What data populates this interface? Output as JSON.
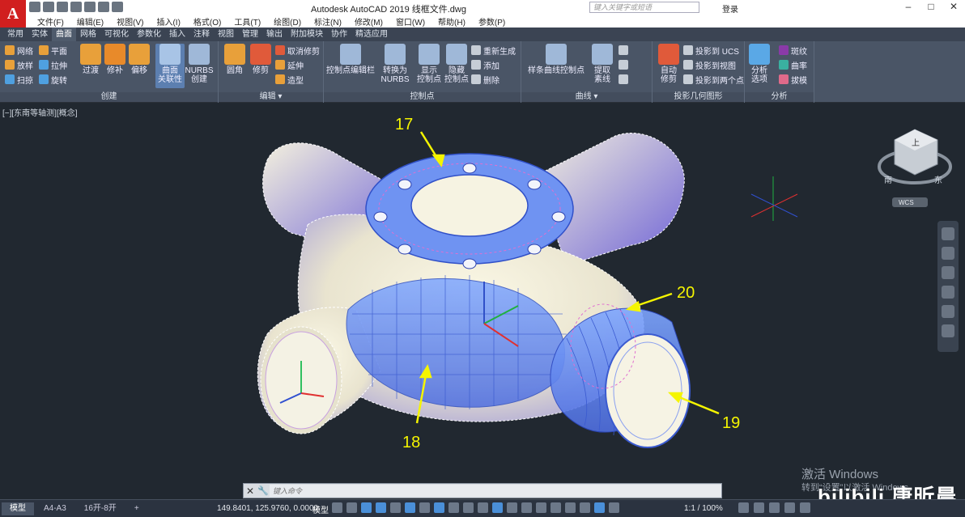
{
  "title_bar": {
    "app_title": "Autodesk AutoCAD 2019   线框文件.dwg",
    "search_placeholder": "键入关键字或短语",
    "login_label": "登录",
    "logo_letter": "A"
  },
  "menu": [
    "文件(F)",
    "编辑(E)",
    "视图(V)",
    "插入(I)",
    "格式(O)",
    "工具(T)",
    "绘图(D)",
    "标注(N)",
    "修改(M)",
    "窗口(W)",
    "帮助(H)",
    "参数(P)"
  ],
  "ribbon_tabs": [
    "常用",
    "实体",
    "曲面",
    "网格",
    "可视化",
    "参数化",
    "插入",
    "注释",
    "视图",
    "管理",
    "输出",
    "附加模块",
    "协作",
    "精选应用"
  ],
  "active_tab": "曲面",
  "panels": {
    "create": {
      "label": "创建",
      "small": [
        "网络",
        "放样",
        "扫掠",
        "平面",
        "拉伸",
        "旋转"
      ],
      "big": [
        "过渡",
        "修补",
        "偏移",
        "曲面\n关联性",
        "NURBS\n创建"
      ]
    },
    "edit": {
      "label": "编辑",
      "big": [
        "圆角",
        "修剪"
      ],
      "small": [
        "取消修剪",
        "延伸",
        "造型"
      ]
    },
    "control_points": {
      "label": "控制点",
      "big": [
        "控制点编辑栏",
        "转换为\nNURBS",
        "显示\n控制点",
        "隐藏\n控制点"
      ],
      "small": [
        "重新生成",
        "添加",
        "删除"
      ]
    },
    "curves": {
      "label": "曲线",
      "big": [
        "样条曲线控制点",
        "提取\n素线"
      ]
    },
    "projection": {
      "label": "投影几何图形",
      "big": [
        "自动\n修剪"
      ],
      "small": [
        "投影到 UCS",
        "投影到视图",
        "投影到两个点"
      ]
    },
    "analysis": {
      "label": "分析",
      "big": [
        "分析\n选项"
      ],
      "small": [
        "斑纹",
        "曲率",
        "拔模"
      ]
    }
  },
  "viewport": {
    "label": "[−][东南等轴测][概念]",
    "callouts": [
      "17",
      "18",
      "19",
      "20"
    ],
    "viewcube": {
      "face": "上",
      "compass_s": "南",
      "compass_e": "东",
      "wcs": "WCS"
    }
  },
  "watermark": {
    "line1": "激活 Windows",
    "line2": "转到“设置”以激活 Windows。",
    "brand": "bilibili 唐昕晨"
  },
  "command_line": {
    "placeholder": "键入命令"
  },
  "status_bar": {
    "layout_tabs": [
      "模型",
      "A4-A3",
      "16开-8开"
    ],
    "active_layout": "模型",
    "coordinates": "149.8401, 125.9760, 0.0000",
    "model_label": "模型",
    "scale": "1:1 / 100%"
  },
  "colors": {
    "accent": "#4a8fd8",
    "callout": "#f5f500",
    "viewport_bg": "#212830"
  }
}
